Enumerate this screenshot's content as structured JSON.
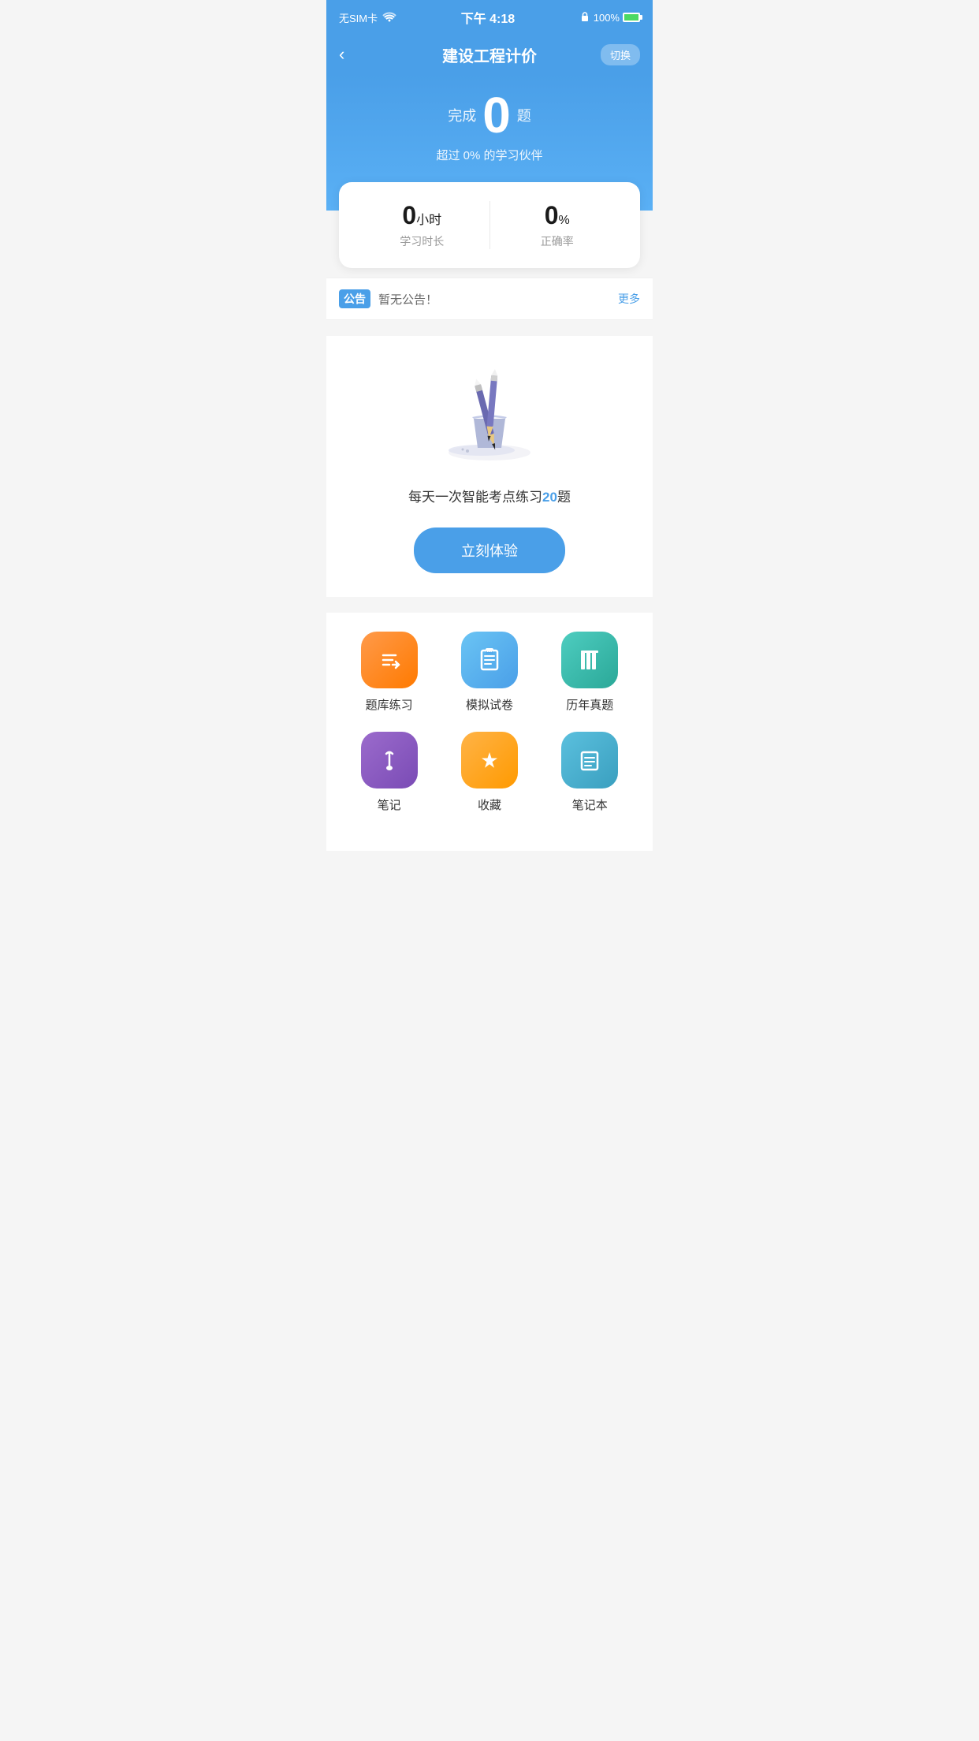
{
  "statusBar": {
    "left": "无SIM卡",
    "wifi": "wifi",
    "time": "下午 4:18",
    "battery_percent": "100%",
    "battery_charging": true
  },
  "header": {
    "back_label": "‹",
    "title": "建设工程计价",
    "switch_label": "切换"
  },
  "hero": {
    "prefix": "完成",
    "count": "0",
    "suffix": "题",
    "subtitle": "超过 0% 的学习伙伴"
  },
  "stats": {
    "study_hours_value": "0",
    "study_hours_unit": "小时",
    "study_hours_label": "学习时长",
    "accuracy_value": "0",
    "accuracy_unit": "%",
    "accuracy_label": "正确率"
  },
  "announcement": {
    "badge": "公告",
    "text": "暂无公告！",
    "more": "更多"
  },
  "daily": {
    "text": "每天一次智能考点练习",
    "highlight_number": "20",
    "highlight_suffix": "题",
    "button_label": "立刻体验"
  },
  "features": {
    "row1": [
      {
        "label": "题库练习",
        "icon_type": "orange",
        "icon_symbol": "✏"
      },
      {
        "label": "模拟试卷",
        "icon_type": "blue",
        "icon_symbol": "📋"
      },
      {
        "label": "历年真题",
        "icon_type": "green",
        "icon_symbol": "📚"
      }
    ],
    "row2": [
      {
        "label": "笔记",
        "icon_type": "purple",
        "icon_symbol": "✒"
      },
      {
        "label": "收藏",
        "icon_type": "star",
        "icon_symbol": "★"
      },
      {
        "label": "笔记本",
        "icon_type": "teal",
        "icon_symbol": "📄"
      }
    ]
  }
}
